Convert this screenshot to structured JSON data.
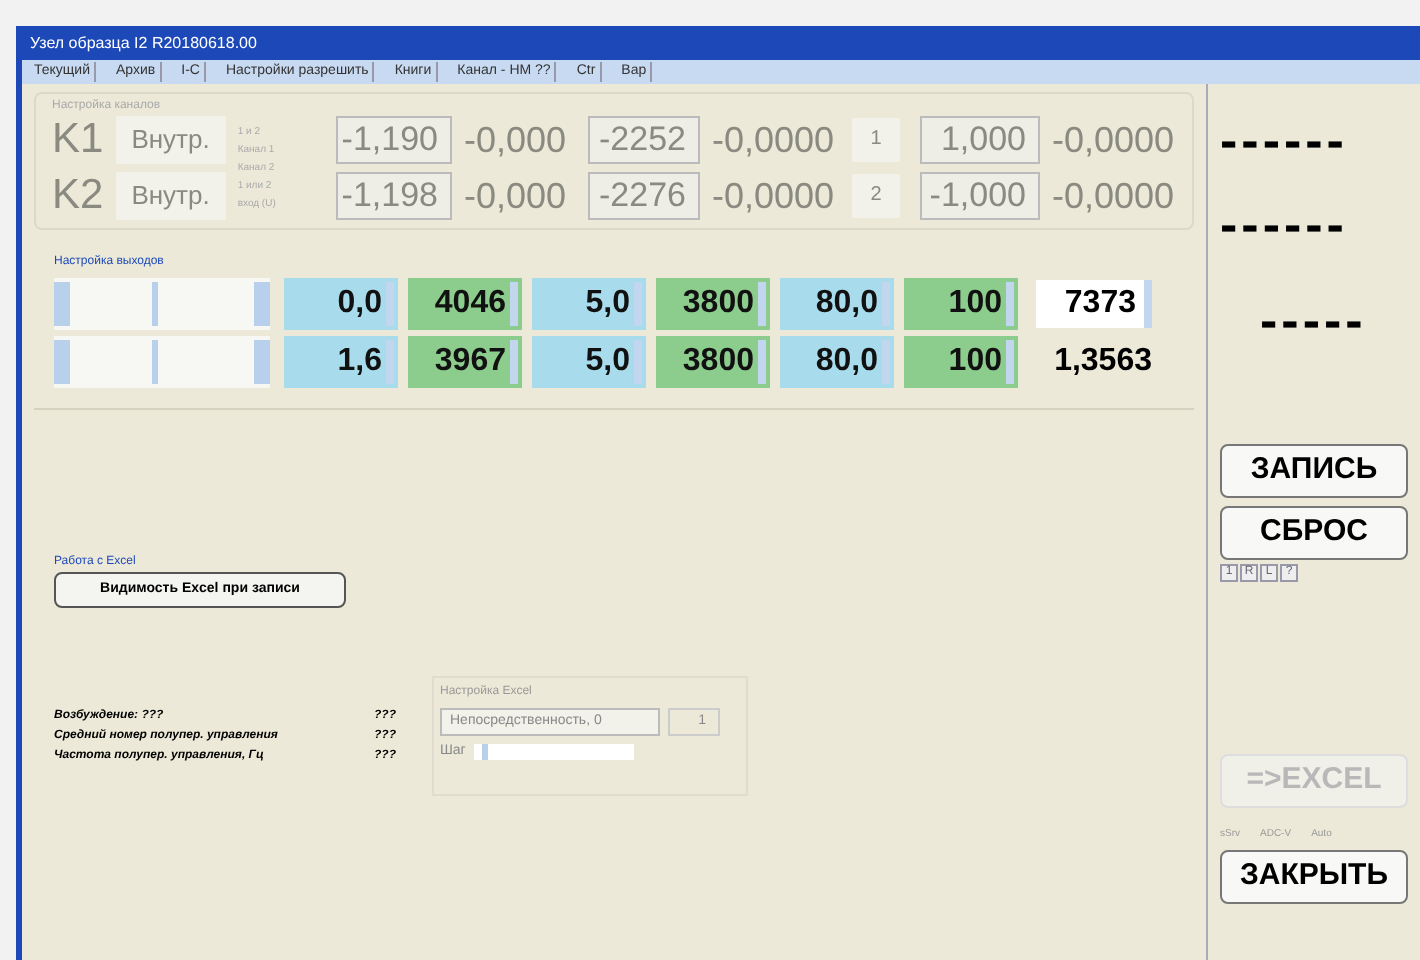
{
  "window": {
    "title": "Узел образца I2 R20180618.00"
  },
  "menu": [
    "Текущий",
    "Архив",
    "I-C",
    "Настройки разрешить",
    "Книги",
    "Канал - НМ ??",
    "Ctr",
    "Вар"
  ],
  "channels_group": {
    "title": "Настройка каналов",
    "disabled": true,
    "mode_labels": [
      "1 и 2",
      "Канал 1",
      "Канал 2",
      "1 или 2",
      "вход (U)"
    ],
    "rows": [
      {
        "name": "K1",
        "source": "Внутр.",
        "field_1": "-1,190",
        "value_1": "-0,000",
        "field_2": "-2252",
        "value_2": "-0,0000",
        "index": "1",
        "field_3": "1,000",
        "value_3": "-0,0000"
      },
      {
        "name": "K2",
        "source": "Внутр.",
        "field_1": "-1,198",
        "value_1": "-0,000",
        "field_2": "-2276",
        "value_2": "-0,0000",
        "index": "2",
        "field_3": "-1,000",
        "value_3": "-0,0000"
      }
    ]
  },
  "outputs_group": {
    "title": "Настройка выходов",
    "rows": [
      {
        "cells": [
          {
            "text": "0,0",
            "color": "#a8dcec"
          },
          {
            "text": "4046",
            "color": "#8ccc8c"
          },
          {
            "text": "5,0",
            "color": "#a8dcec"
          },
          {
            "text": "3800",
            "color": "#8ccc8c"
          },
          {
            "text": "80,0",
            "color": "#a8dcec"
          },
          {
            "text": "100",
            "color": "#8ccc8c"
          }
        ],
        "slider": {
          "level": 0.45
        },
        "result": {
          "kind": "field",
          "text": "7373"
        }
      },
      {
        "cells": [
          {
            "text": "1,6",
            "color": "#a8dcec"
          },
          {
            "text": "3967",
            "color": "#8ccc8c"
          },
          {
            "text": "5,0",
            "color": "#a8dcec"
          },
          {
            "text": "3800",
            "color": "#8ccc8c"
          },
          {
            "text": "80,0",
            "color": "#a8dcec"
          },
          {
            "text": "100",
            "color": "#8ccc8c"
          }
        ],
        "slider": {
          "level": 0.45
        },
        "result": {
          "kind": "text",
          "text": "1,3563"
        }
      }
    ]
  },
  "excel_group": {
    "title": "Работа с Excel",
    "button": "Видимость Excel при записи"
  },
  "status_lines": [
    {
      "label": "Возбуждение: ???",
      "value": "???"
    },
    {
      "label": "Средний номер полупер. управления",
      "value": "???"
    },
    {
      "label": "Частота полупер. управления, Гц",
      "value": "???"
    }
  ],
  "excel_settings": {
    "title": "Настройка Excel",
    "disabled": true,
    "combo": "Непосредственность, 0",
    "spinner": "1",
    "step_label": "Шаг",
    "step_slider": {
      "level": 0.05
    }
  },
  "readouts": [
    "------",
    "------",
    "-----"
  ],
  "buttons": [
    {
      "label": "ЗАПИСЬ",
      "disabled": false
    },
    {
      "label": "СБРОС",
      "disabled": false
    }
  ],
  "mini_buttons": [
    "1",
    "R",
    "L",
    "?"
  ],
  "excel_button": {
    "label": "=>EXCEL",
    "disabled": true
  },
  "small_labels": [
    "sSrv",
    "ADC-V",
    "Auto"
  ],
  "close_button": {
    "label": "ЗАКРЫТЬ",
    "disabled": false
  }
}
